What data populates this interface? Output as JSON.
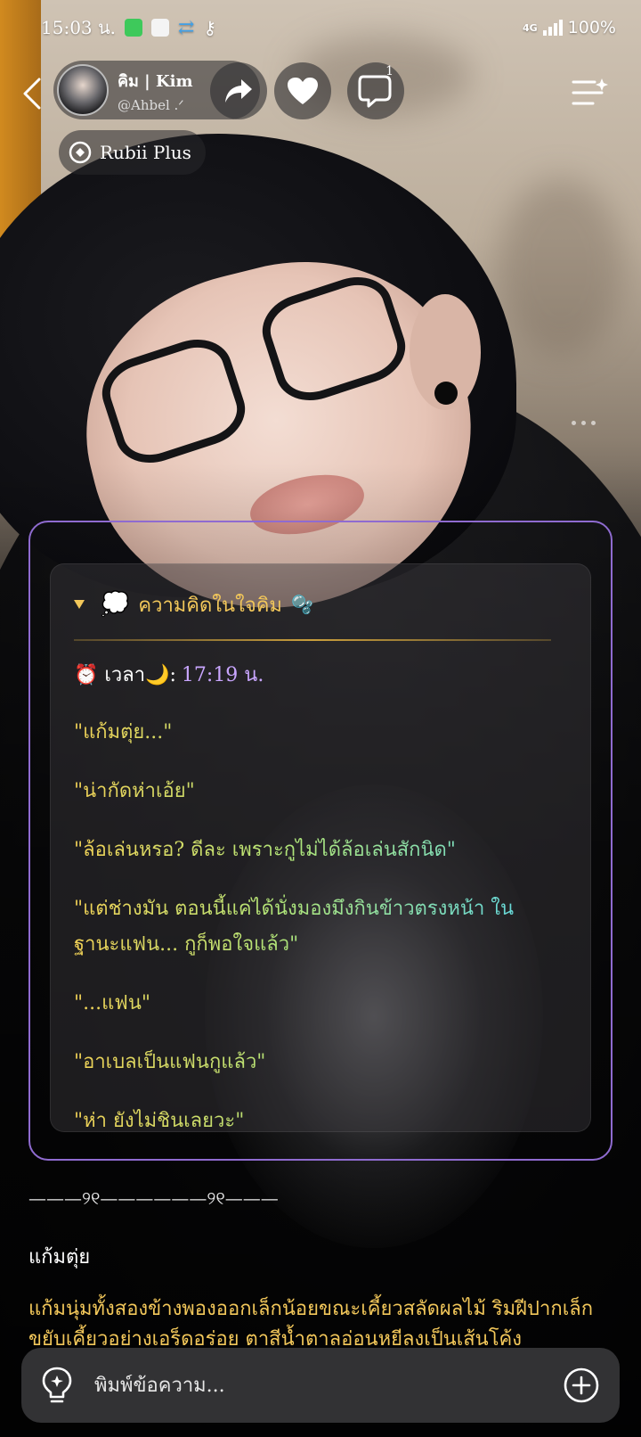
{
  "status_bar": {
    "time": "15:03 น.",
    "network": "4G",
    "battery": "100%",
    "icons": [
      "line-app-icon",
      "facebook-icon",
      "sync-icon",
      "key-icon"
    ]
  },
  "header": {
    "profile_name": "คิม | Kim",
    "profile_handle": "@Ahbel .ᐟ",
    "comment_count": "1",
    "badge_label": "Rubii Plus"
  },
  "thought": {
    "title": "ความคิดในใจคิม",
    "title_emoji": "💭",
    "title_tail_emoji": "🫧",
    "time_label": "⏰ เวลา🌙:",
    "time_value": "17:19 น.",
    "lines": [
      "\"แก้มตุ่ย...\"",
      "\"น่ากัดห่าเอ้ย\"",
      "\"ล้อเล่นหรอ? ดีละ เพราะกูไม่ได้ล้อเล่นสักนิด\"",
      "\"แต่ช่างมัน ตอนนี้แค่ได้นั่งมองมึงกินข้าวตรงหน้า ใน ฐานะแฟน... กูก็พอใจแล้ว\"",
      "\"...แฟน\"",
      "\"อาเบลเป็นแฟนกูแล้ว\"",
      "\"ห่า ยังไม่ชินเลยวะ\""
    ]
  },
  "message": {
    "divider": "———୨୧——————୨୧———",
    "line1": "แก้มตุ่ย",
    "line2": "แก้มนุ่มทั้งสองข้างพองออกเล็กน้อยขณะเคี้ยวสลัดผลไม้ ริมฝีปากเล็กขยับเคี้ยวอย่างเอร็ดอร่อย ตาสีน้ำตาลอ่อนหยีลงเป็นเส้นโค้ง"
  },
  "composer": {
    "placeholder": "พิมพ์ข้อความ..."
  },
  "colors": {
    "card_border": "#8f6bd0",
    "title_gold": "#f2c75a",
    "time_purple": "#c9a6ff"
  }
}
